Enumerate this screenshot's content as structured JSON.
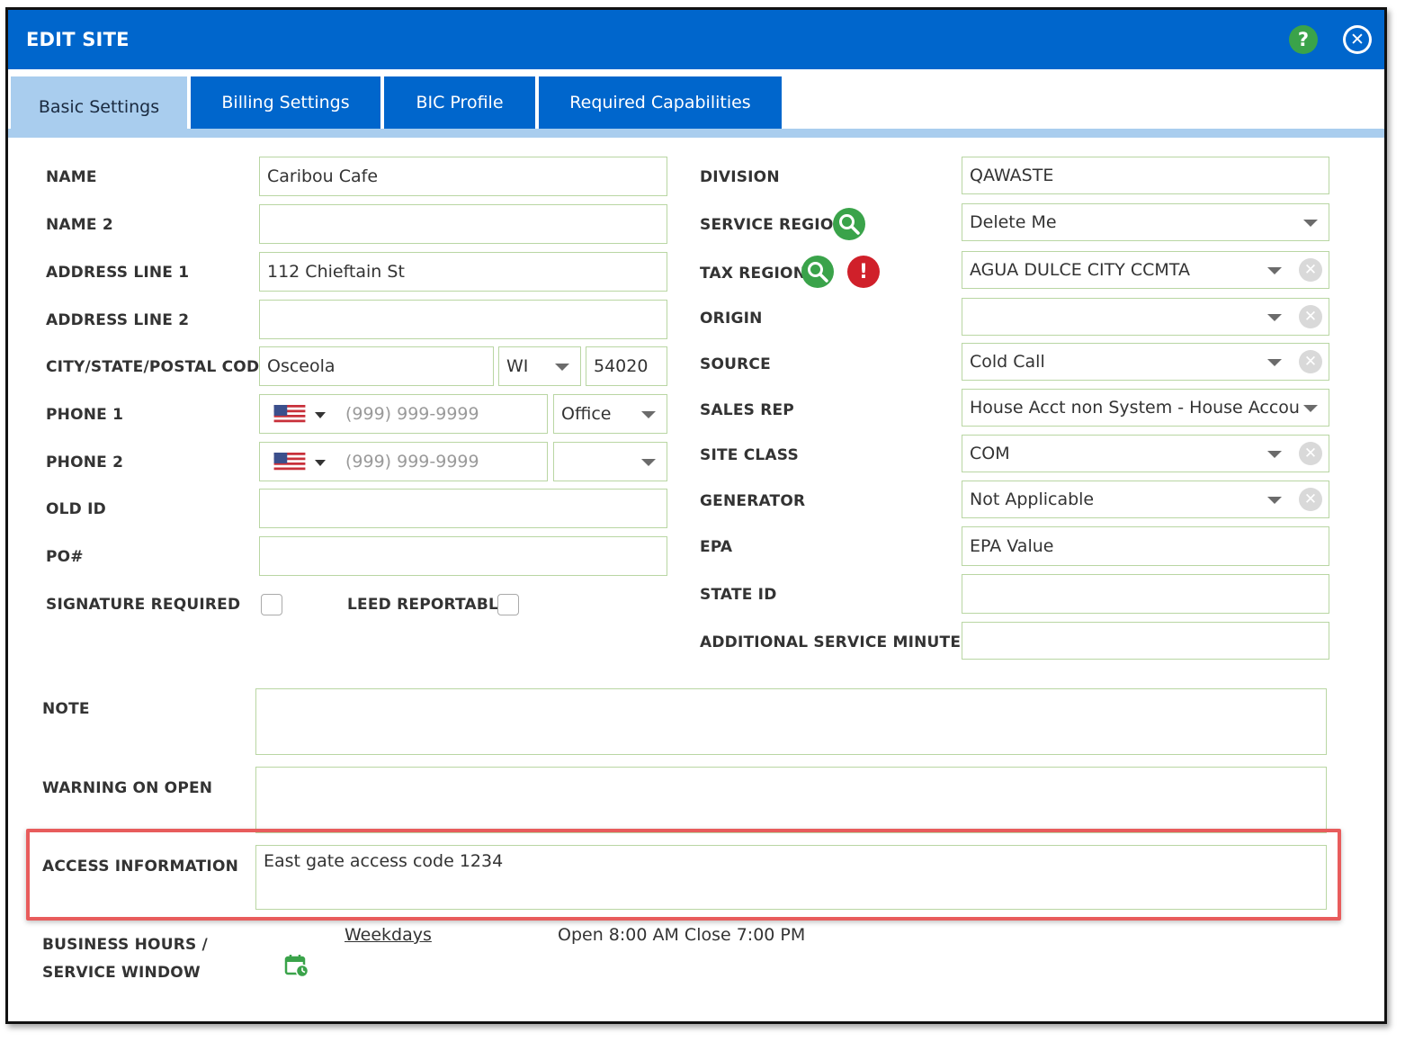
{
  "dialog": {
    "title": "EDIT SITE",
    "help_glyph": "?",
    "close_glyph": "✕"
  },
  "tabs": [
    {
      "label": "Basic Settings",
      "active": true
    },
    {
      "label": "Billing Settings",
      "active": false
    },
    {
      "label": "BIC Profile",
      "active": false
    },
    {
      "label": "Required Capabilities",
      "active": false
    }
  ],
  "left": {
    "name": {
      "label": "NAME",
      "value": "Caribou Cafe"
    },
    "name2": {
      "label": "NAME 2",
      "value": ""
    },
    "address1": {
      "label": "ADDRESS LINE 1",
      "value": "112 Chieftain St"
    },
    "address2": {
      "label": "ADDRESS LINE 2",
      "value": ""
    },
    "city_state_zip": {
      "label": "CITY/STATE/POSTAL CODE",
      "city": "Osceola",
      "state": "WI",
      "zip": "54020"
    },
    "phone1": {
      "label": "PHONE 1",
      "placeholder": "(999) 999-9999",
      "type": "Office"
    },
    "phone2": {
      "label": "PHONE 2",
      "placeholder": "(999) 999-9999",
      "type": ""
    },
    "old_id": {
      "label": "OLD ID",
      "value": ""
    },
    "po": {
      "label": "PO#",
      "value": ""
    },
    "signature_required": {
      "label": "SIGNATURE REQUIRED",
      "checked": false
    },
    "leed_reportable": {
      "label": "LEED REPORTABLE",
      "checked": false
    }
  },
  "right": {
    "division": {
      "label": "DIVISION",
      "value": "QAWASTE"
    },
    "service_region": {
      "label": "SERVICE REGION",
      "value": "Delete Me"
    },
    "tax_region": {
      "label": "TAX REGION",
      "value": "AGUA DULCE CITY CCMTA",
      "alert_glyph": "!"
    },
    "origin": {
      "label": "ORIGIN",
      "value": ""
    },
    "source": {
      "label": "SOURCE",
      "value": "Cold Call"
    },
    "sales_rep": {
      "label": "SALES REP",
      "value": "House Acct non System - House Accou"
    },
    "site_class": {
      "label": "SITE CLASS",
      "value": "COM"
    },
    "generator": {
      "label": "GENERATOR",
      "value": "Not Applicable"
    },
    "epa": {
      "label": "EPA",
      "value": "EPA Value"
    },
    "state_id": {
      "label": "STATE ID",
      "value": ""
    },
    "additional_minutes": {
      "label": "ADDITIONAL SERVICE MINUTES",
      "value": ""
    }
  },
  "bottom": {
    "note": {
      "label": "NOTE",
      "value": ""
    },
    "warning": {
      "label": "WARNING ON OPEN",
      "value": ""
    },
    "access": {
      "label": "ACCESS INFORMATION",
      "value": "East gate access code 1234"
    },
    "business_hours": {
      "label_line1": "BUSINESS HOURS /",
      "label_line2": "SERVICE WINDOW",
      "schedule_link": "Weekdays",
      "schedule_text": "Open 8:00 AM Close 7:00 PM"
    }
  },
  "colors": {
    "header": "#0066cc",
    "tab_active": "#a9cdee",
    "field_border": "#b9d6a3",
    "search_green": "#3aa34a",
    "alert_red": "#d0202a",
    "highlight_red": "#e85c5c"
  },
  "icons": {
    "search": "search-icon",
    "alert": "alert-icon",
    "calendar": "calendar-clock-icon",
    "flag": "us-flag-icon"
  }
}
